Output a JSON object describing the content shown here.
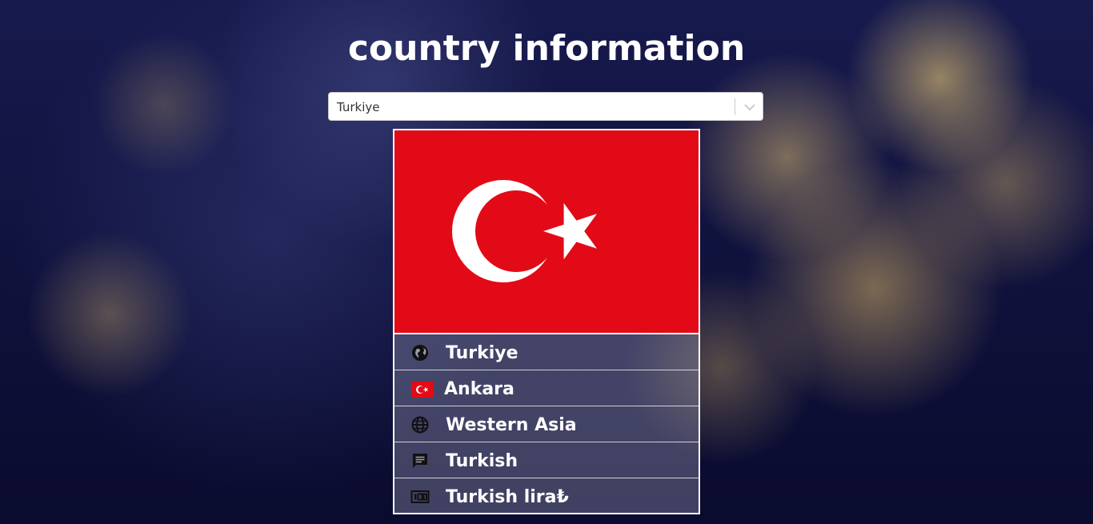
{
  "page": {
    "title": "country information"
  },
  "country_select": {
    "selected_value": "Turkiye",
    "icon": "chevron-down-icon"
  },
  "country_card": {
    "flag": {
      "icon": "turkey-flag",
      "background_color": "#e30a17",
      "emblem_color": "#ffffff"
    },
    "details": [
      {
        "icon": "globe-icon",
        "value": "Turkiye"
      },
      {
        "icon": "turkey-flag-icon",
        "value": "Ankara"
      },
      {
        "icon": "language-globe-icon",
        "value": "Western Asia"
      },
      {
        "icon": "chat-icon",
        "value": "Turkish"
      },
      {
        "icon": "money-icon",
        "value": "Turkish lira₺"
      }
    ]
  }
}
